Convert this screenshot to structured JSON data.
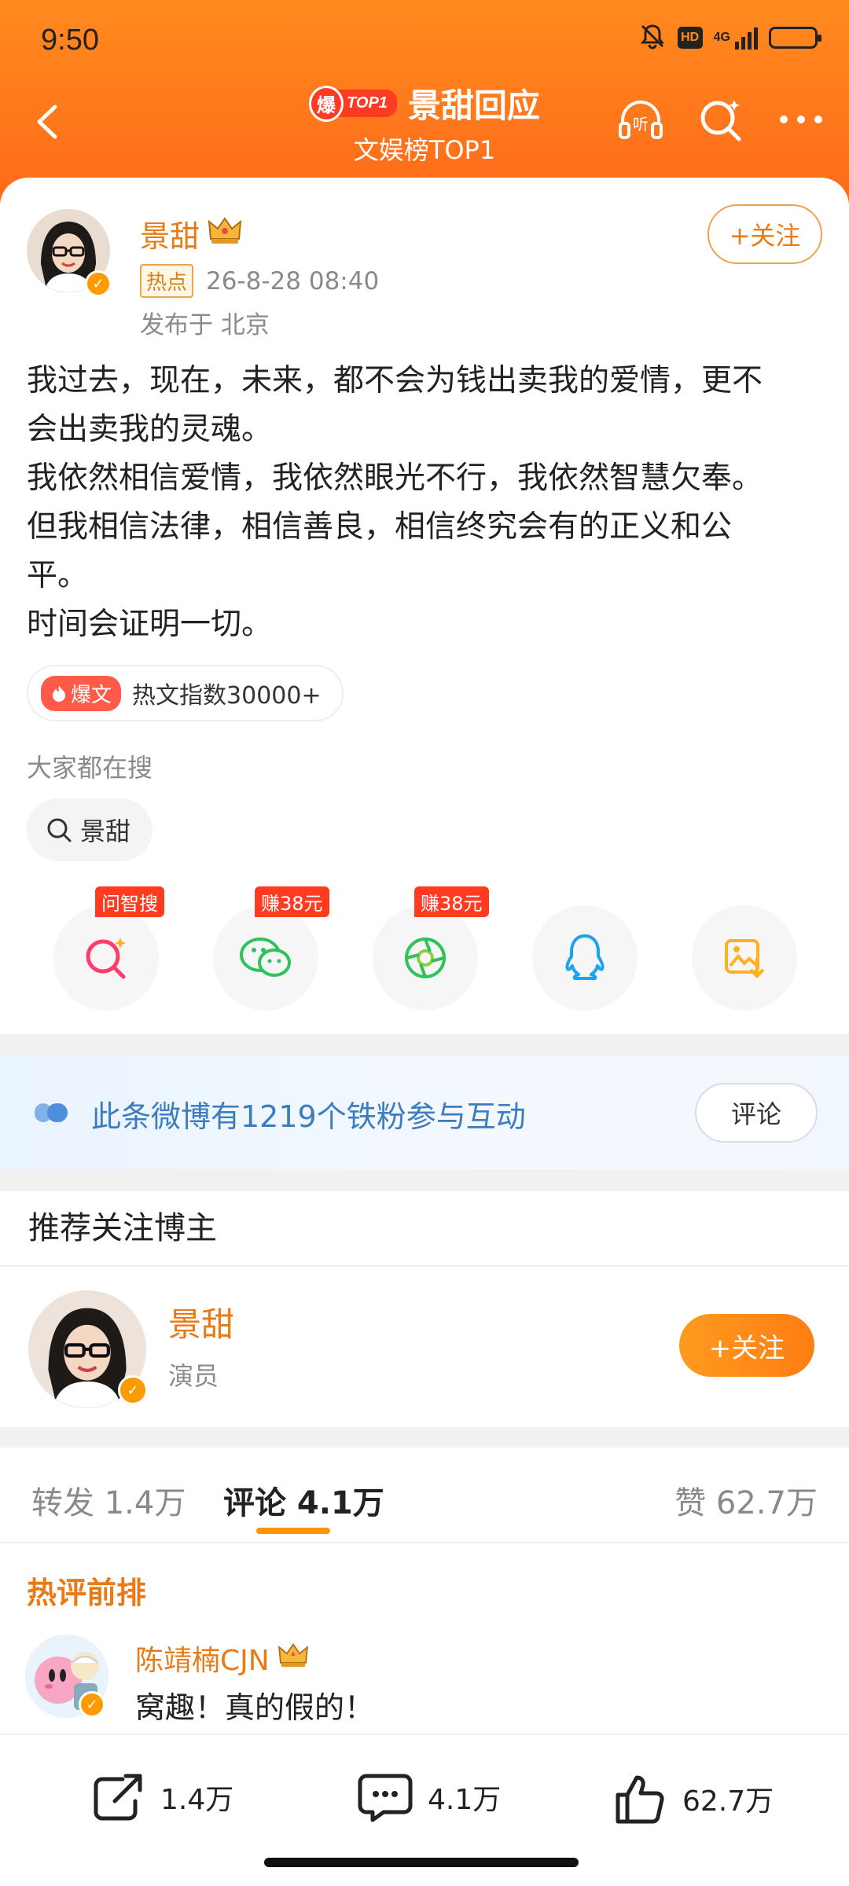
{
  "status_bar": {
    "time": "9:50",
    "network": "4G",
    "hd": "HD"
  },
  "nav": {
    "badge_burst": "爆",
    "badge_top": "TOP1",
    "title": "景甜回应",
    "subtitle": "文娱榜TOP1",
    "listen_label": "听"
  },
  "post": {
    "author": "景甜",
    "tag": "热点",
    "timestamp": "26-8-28 08:40",
    "location": "发布于 北京",
    "follow_label": "+关注",
    "lines": [
      "我过去，现在，未来，都不会为钱出卖我的爱情，更不",
      "会出卖我的灵魂。",
      "我依然相信爱情，我依然眼光不行，我依然智慧欠奉。",
      "但我相信法律，相信善良，相信终究会有的正义和公",
      "平。",
      "时间会证明一切。"
    ],
    "heat_tag": "爆文",
    "heat_text": "热文指数30000+",
    "search_label": "大家都在搜",
    "search_chip": "景甜",
    "share": [
      {
        "tag": "问智搜",
        "icon": "search-ai-icon"
      },
      {
        "tag": "赚38元",
        "icon": "wechat-icon"
      },
      {
        "tag": "赚38元",
        "icon": "moments-icon"
      },
      {
        "tag": "",
        "icon": "qq-icon"
      },
      {
        "tag": "",
        "icon": "save-image-icon"
      }
    ]
  },
  "fan_banner": {
    "text": "此条微博有1219个铁粉参与互动",
    "button": "评论",
    "accent": "#3e7cc0"
  },
  "recommend": {
    "title": "推荐关注博主",
    "name": "景甜",
    "desc": "演员",
    "follow_label": "+关注"
  },
  "tabs": {
    "repost": "转发 1.4万",
    "comment": "评论 4.1万",
    "like": "赞 62.7万",
    "active": "comment"
  },
  "comments": {
    "section_title": "热评前排",
    "items": [
      {
        "name": "陈靖楠CJN",
        "text": "窝趣！真的假的！"
      }
    ]
  },
  "bottom_bar": {
    "repost": "1.4万",
    "comment": "4.1万",
    "like": "62.7万"
  },
  "colors": {
    "brand_orange": "#ff8a1e",
    "name_orange": "#e97b16",
    "tag_red": "#ff3b22"
  }
}
